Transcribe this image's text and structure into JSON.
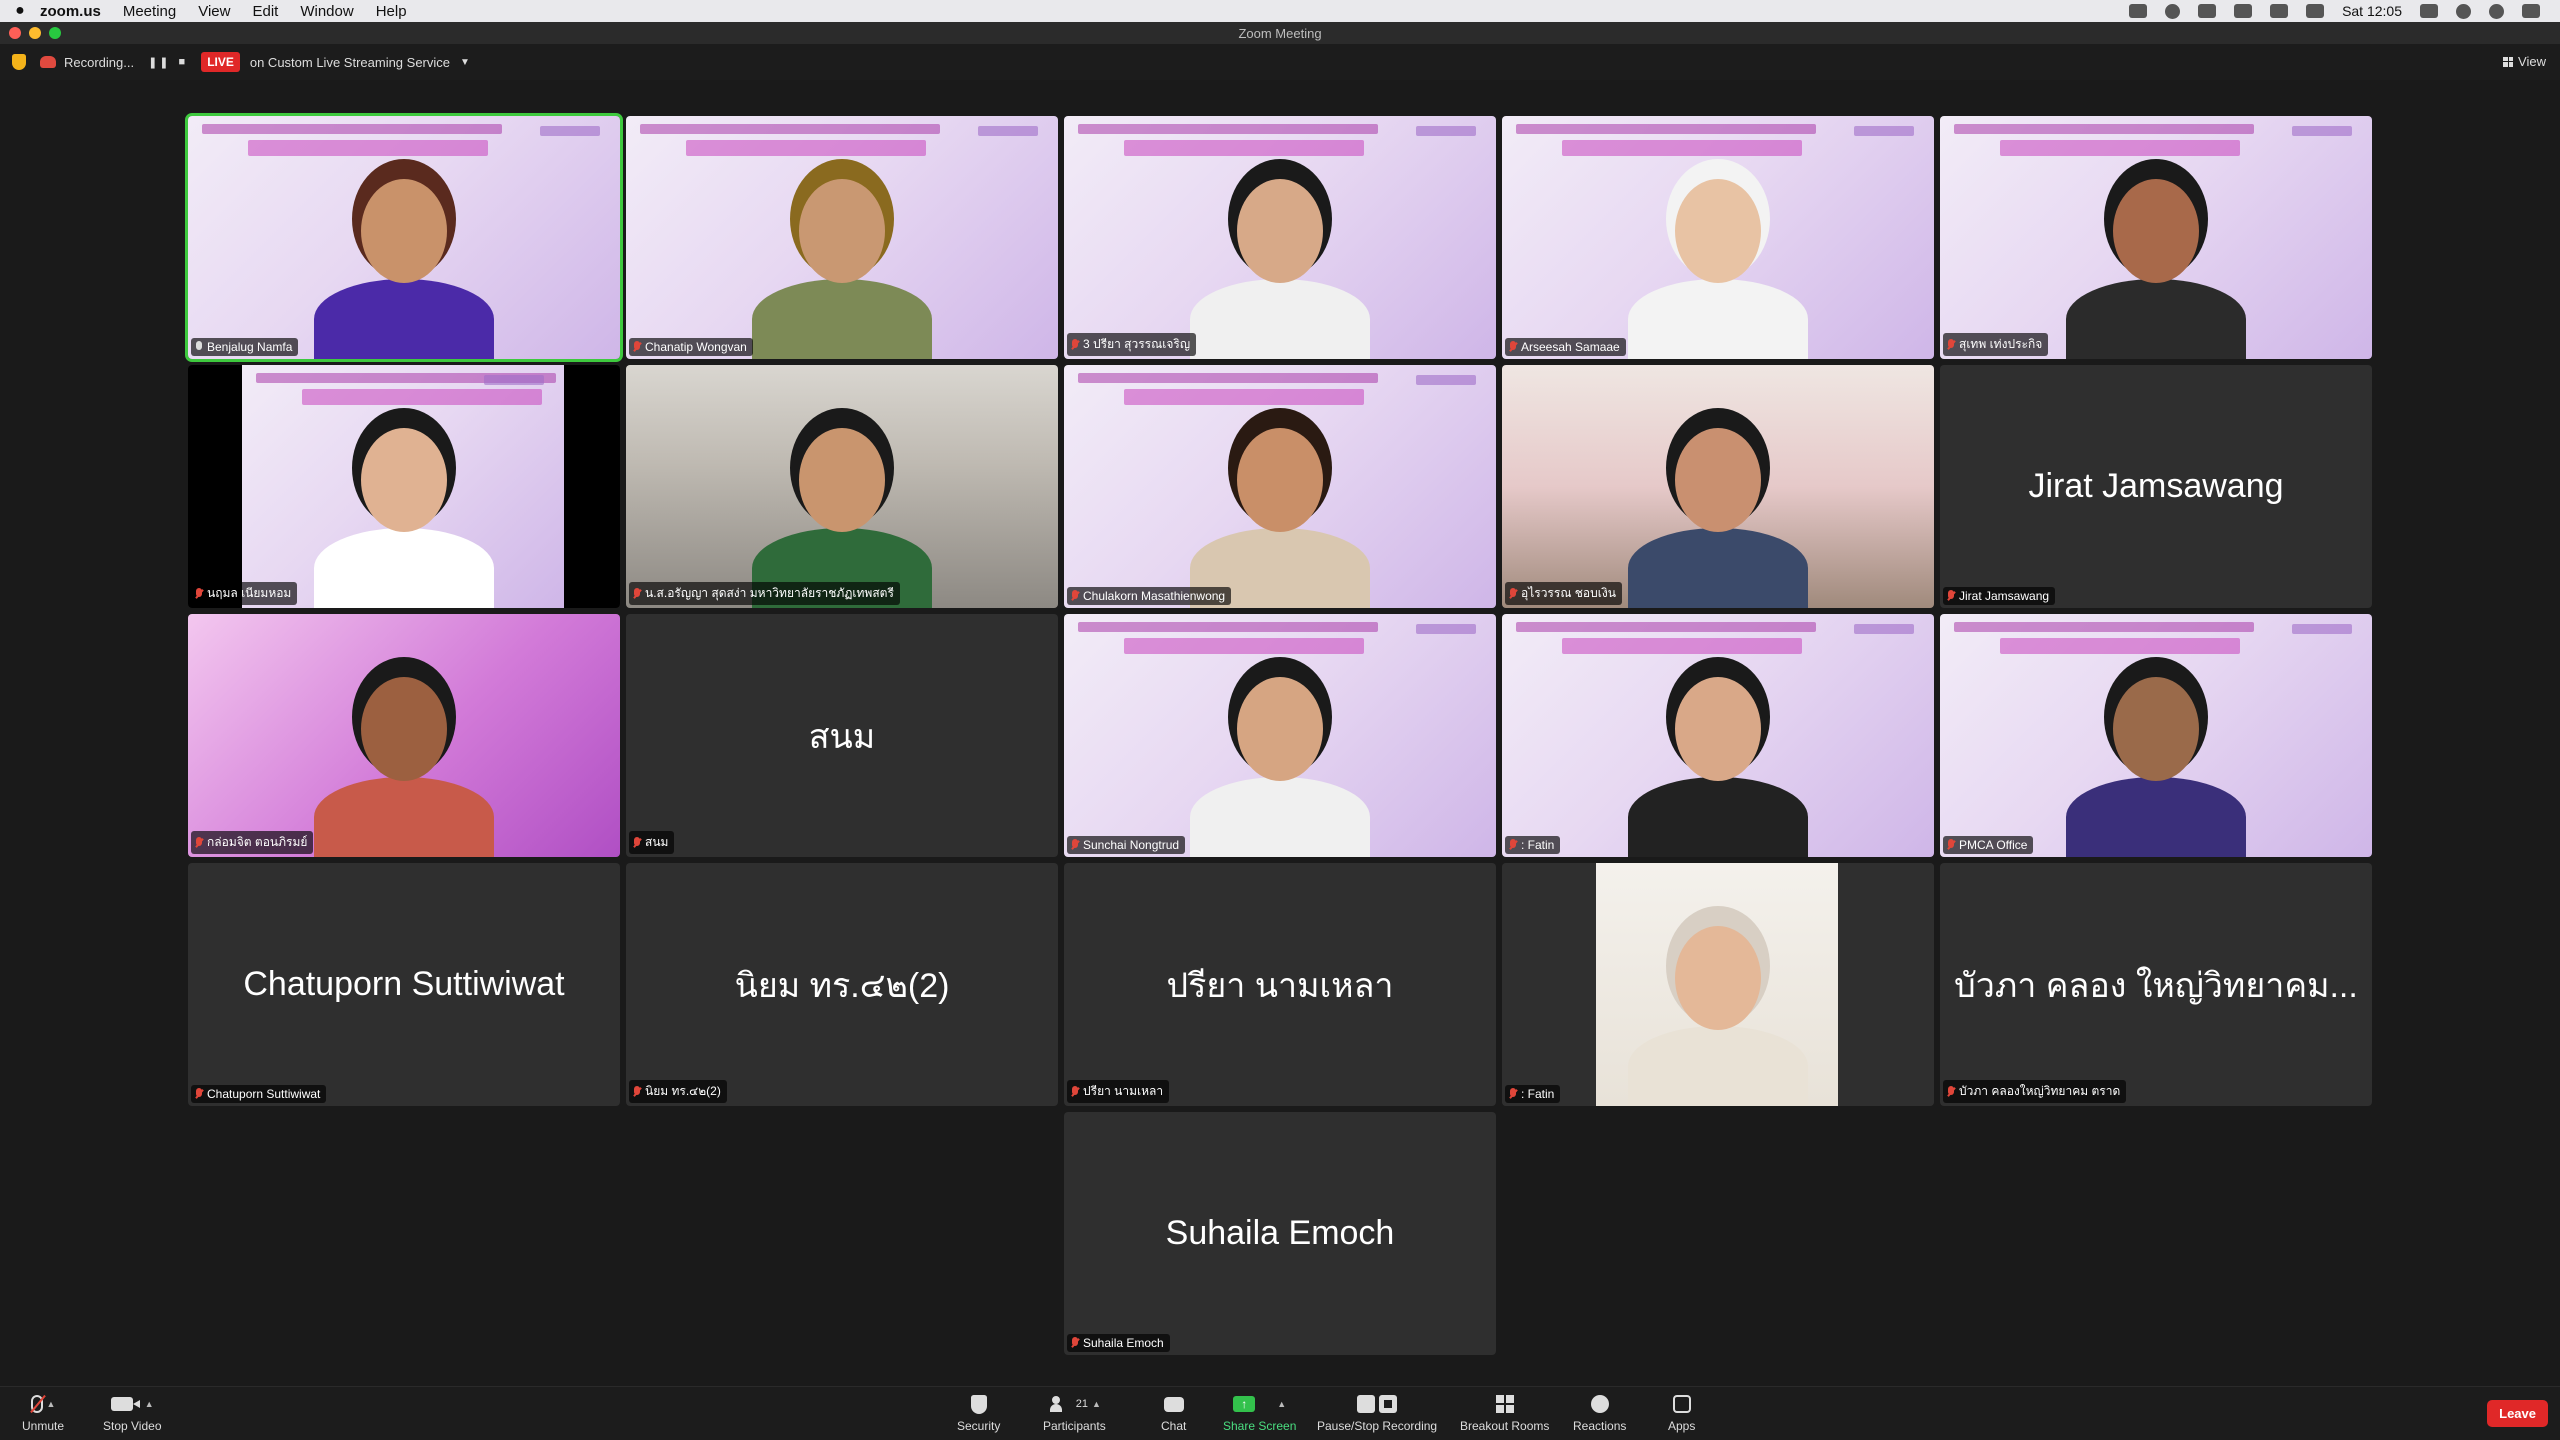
{
  "menubar": {
    "app": "zoom.us",
    "items": [
      "Meeting",
      "View",
      "Edit",
      "Window",
      "Help"
    ],
    "clock": "Sat 12:05"
  },
  "window": {
    "title": "Zoom Meeting"
  },
  "recording": {
    "label": "Recording...",
    "live": "LIVE",
    "stream": "on Custom Live Streaming Service",
    "view": "View"
  },
  "participants": [
    {
      "name": "Benjalug Namfa",
      "muted": false,
      "type": "video",
      "bg": "slide",
      "skin": "#c9926a",
      "hair": "#5a2a1e",
      "shirt": "#4b2aa8",
      "active": true
    },
    {
      "name": "Chanatip Wongvan",
      "muted": true,
      "type": "video",
      "bg": "slide",
      "skin": "#c99872",
      "hair": "#8a6a1f",
      "shirt": "#7d8a56"
    },
    {
      "name": "3 ปรียา สุวรรณเจริญ",
      "muted": true,
      "type": "video",
      "bg": "slide",
      "skin": "#d7a988",
      "hair": "#1a1a1a",
      "shirt": "#f0f0f0"
    },
    {
      "name": "Arseesah Samaae",
      "muted": true,
      "type": "video",
      "bg": "slide",
      "skin": "#e8c3a4",
      "hair": "#f3f3f3",
      "shirt": "#f3f3f3"
    },
    {
      "name": "สุเทพ เท่งประกิจ",
      "muted": true,
      "type": "video",
      "bg": "slide",
      "skin": "#a8694a",
      "hair": "#1a1a1a",
      "shirt": "#2b2b2b"
    },
    {
      "name": "นฤมล เนียมหอม",
      "muted": true,
      "type": "video",
      "bg": "slide-narrow",
      "skin": "#e0b292",
      "hair": "#1a1a1a",
      "shirt": "#ffffff"
    },
    {
      "name": "น.ส.อรัญญา สุดสง่า มหาวิทยาลัยราชภัฏเทพสตรี",
      "muted": true,
      "type": "video",
      "bg": "car",
      "skin": "#c9956e",
      "hair": "#1a1a1a",
      "shirt": "#2f6b3a"
    },
    {
      "name": "Chulakorn Masathienwong",
      "muted": true,
      "type": "video",
      "bg": "slide",
      "skin": "#c98f68",
      "hair": "#2a1a12",
      "shirt": "#d9c7b0"
    },
    {
      "name": "อุไรวรรณ ชอบเงิน",
      "muted": true,
      "type": "video",
      "bg": "office",
      "skin": "#c99070",
      "hair": "#1a1a1a",
      "shirt": "#3b4a6a"
    },
    {
      "name": "Jirat Jamsawang",
      "muted": true,
      "type": "name"
    },
    {
      "name": "กล่อมจิต ตอนภิรมย์",
      "muted": true,
      "type": "video",
      "bg": "pink",
      "skin": "#9c6040",
      "hair": "#1a1a1a",
      "shirt": "#c85a4a"
    },
    {
      "name": "สนม",
      "muted": true,
      "type": "name"
    },
    {
      "name": "Sunchai Nongtrud",
      "muted": true,
      "type": "video",
      "bg": "slide",
      "skin": "#d6a582",
      "hair": "#1a1a1a",
      "shirt": "#f0f0f0"
    },
    {
      "name": ": Fatin",
      "muted": true,
      "type": "video",
      "bg": "slide",
      "skin": "#d9a888",
      "hair": "#1a1a1a",
      "shirt": "#222222"
    },
    {
      "name": "PMCA Office",
      "muted": true,
      "type": "video",
      "bg": "slide",
      "skin": "#9a6a4a",
      "hair": "#1a1a1a",
      "shirt": "#3a2f7a"
    },
    {
      "name": "Chatuporn Suttiwiwat",
      "muted": true,
      "type": "name"
    },
    {
      "name": "นิยม ทร.๔๒(2)",
      "muted": true,
      "type": "name"
    },
    {
      "name": "ปรียา นามเหลา",
      "muted": true,
      "type": "name"
    },
    {
      "name": ": Fatin",
      "muted": true,
      "type": "video",
      "bg": "portrait",
      "skin": "#e4b898",
      "hair": "#d8cfc4",
      "shirt": "#e9e2d6"
    },
    {
      "name": "บัวภา คลองใหญ่วิทยาคม ตราด",
      "display": "บัวภา คลอง ใหญ่วิทยาคม...",
      "muted": true,
      "type": "name"
    },
    {
      "name": "Suhaila Emoch",
      "muted": true,
      "type": "name"
    }
  ],
  "toolbar": {
    "unmute": "Unmute",
    "stop_video": "Stop Video",
    "security": "Security",
    "participants": "Participants",
    "participants_count": "21",
    "chat": "Chat",
    "share": "Share Screen",
    "recording": "Pause/Stop Recording",
    "breakout": "Breakout Rooms",
    "reactions": "Reactions",
    "apps": "Apps",
    "leave": "Leave"
  },
  "colors": {
    "accent_green": "#3ec93e",
    "leave_red": "#e02828",
    "muted_red": "#e0463a"
  }
}
